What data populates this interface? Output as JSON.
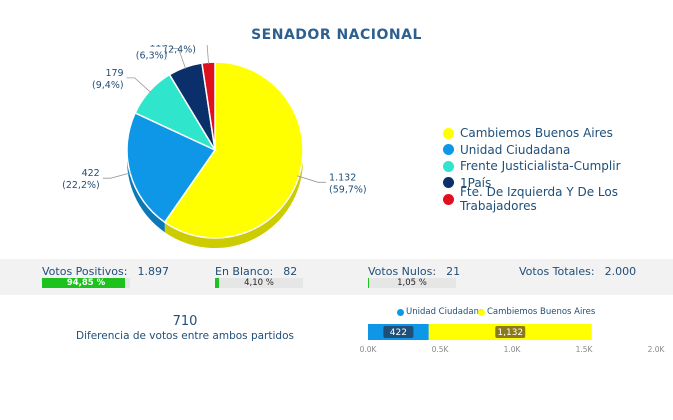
{
  "title": "SENADOR NACIONAL",
  "chart_data": [
    {
      "type": "pie",
      "slices": [
        {
          "name": "Cambiemos Buenos Aires",
          "value": 1132,
          "value_label": "1.132",
          "pct_label": "(59,7%)",
          "color": "#ffff00"
        },
        {
          "name": "Unidad Ciudadana",
          "value": 422,
          "value_label": "422",
          "pct_label": "(22,2%)",
          "color": "#0e97e6"
        },
        {
          "name": "Frente Justicialista-Cumplir",
          "value": 179,
          "value_label": "179",
          "pct_label": "(9,4%)",
          "color": "#2fe6cd"
        },
        {
          "name": "1País",
          "value": 119,
          "value_label": "119",
          "pct_label": "(6,3%)",
          "color": "#0b2f6b"
        },
        {
          "name": "Fte. De Izquierda Y De Los Trabajadores",
          "value": 45,
          "value_label": "45",
          "pct_label": "(2,4%)",
          "color": "#e0101f"
        }
      ]
    },
    {
      "type": "bar",
      "orientation": "horizontal",
      "stacked": true,
      "series": [
        {
          "name": "Unidad Ciudadana",
          "value": 422,
          "label": "422",
          "color": "#0e97e6"
        },
        {
          "name": "Cambiemos Buenos Aires",
          "value": 1132,
          "label": "1,132",
          "color": "#ffff00"
        }
      ],
      "xlim": [
        0,
        2000
      ],
      "ticks": [
        0,
        500,
        1000,
        1500,
        2000
      ],
      "tick_labels": [
        "0.0K",
        "0.5K",
        "1.0K",
        "1.5K",
        "2.0K"
      ]
    }
  ],
  "stats": {
    "positivos": {
      "label": "Votos Positivos:",
      "value": "1.897",
      "pct": 94.85,
      "pct_label": "94,85 %"
    },
    "blanco": {
      "label": "En Blanco:",
      "value": "82",
      "pct": 4.1,
      "pct_label": "4,10 %"
    },
    "nulos": {
      "label": "Votos Nulos:",
      "value": "21",
      "pct": 1.05,
      "pct_label": "1,05 %"
    },
    "totales": {
      "label": "Votos Totales:",
      "value": "2.000"
    }
  },
  "difference": {
    "value": "710",
    "label": "Diferencia de votos entre ambos partidos"
  }
}
